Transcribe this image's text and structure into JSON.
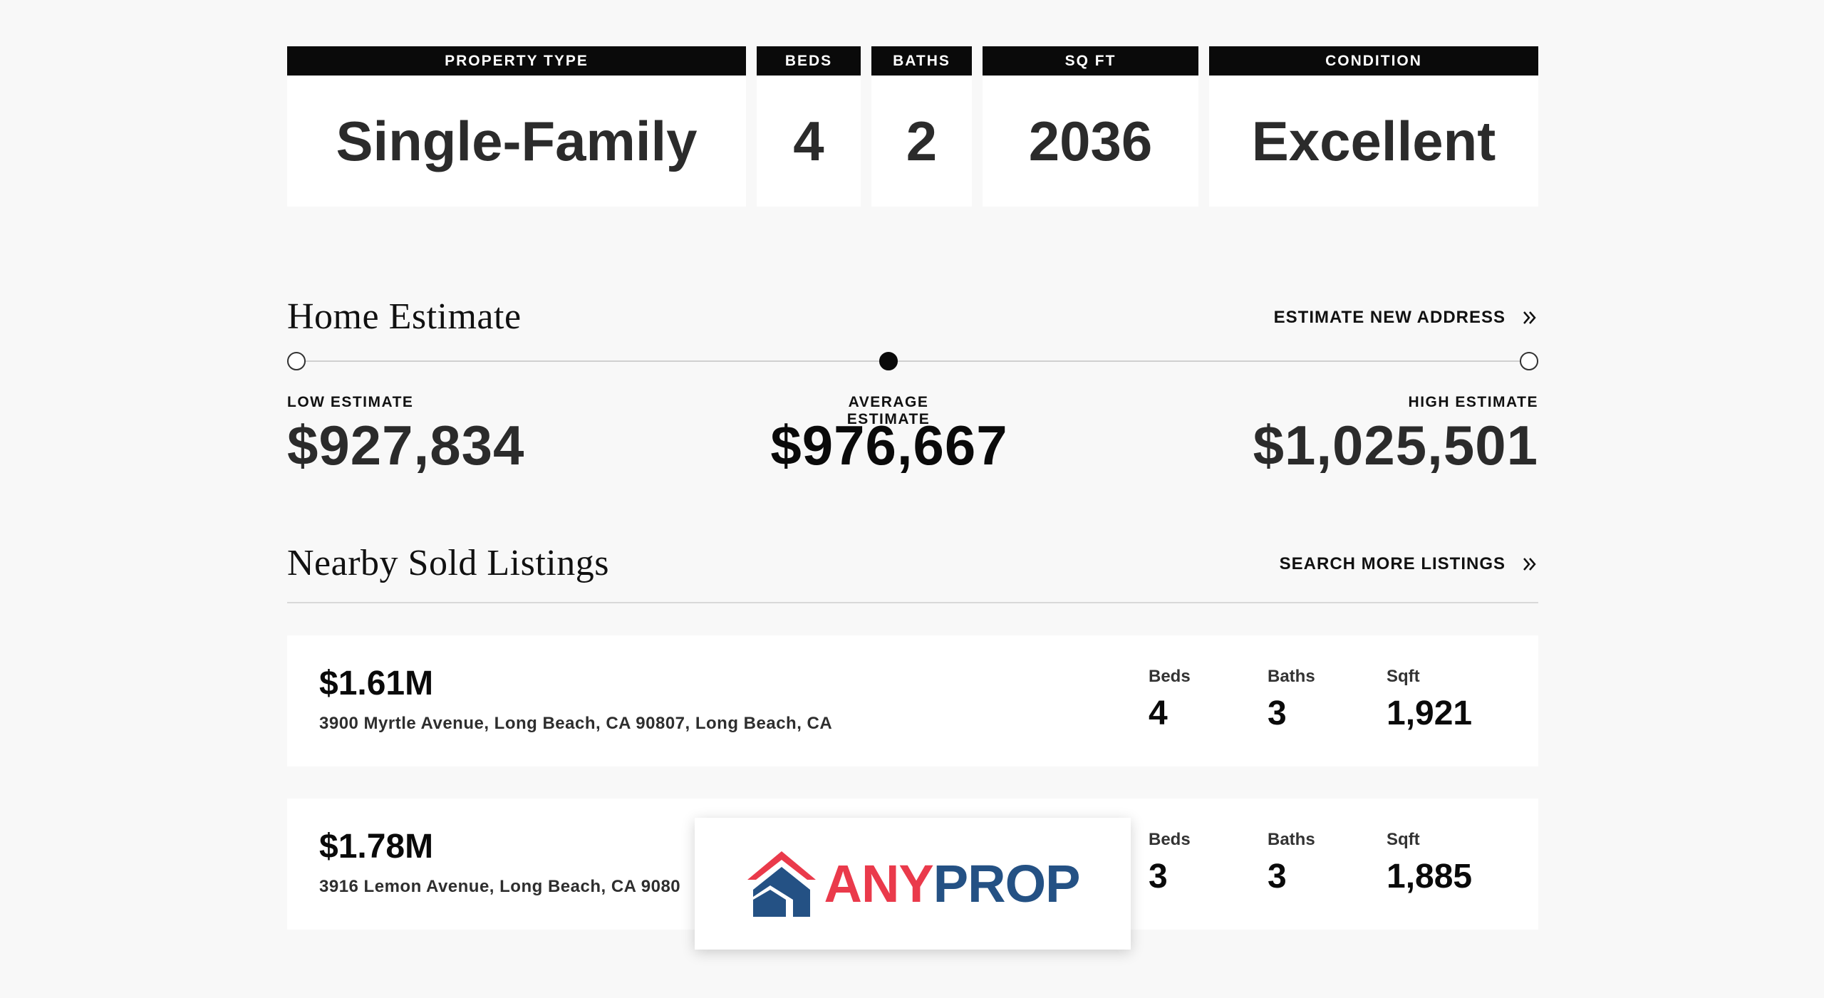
{
  "property_stats": [
    {
      "label": "PROPERTY TYPE",
      "value": "Single-Family"
    },
    {
      "label": "BEDS",
      "value": "4"
    },
    {
      "label": "BATHS",
      "value": "2"
    },
    {
      "label": "SQ FT",
      "value": "2036"
    },
    {
      "label": "CONDITION",
      "value": "Excellent"
    }
  ],
  "home_estimate": {
    "title": "Home Estimate",
    "link_label": "ESTIMATE NEW ADDRESS",
    "low_label": "LOW ESTIMATE",
    "low_value": "$927,834",
    "avg_label": "AVERAGE ESTIMATE",
    "avg_value": "$976,667",
    "high_label": "HIGH ESTIMATE",
    "high_value": "$1,025,501"
  },
  "nearby": {
    "title": "Nearby Sold Listings",
    "link_label": "SEARCH MORE LISTINGS",
    "listings": [
      {
        "price": "$1.61M",
        "address": "3900 Myrtle Avenue, Long Beach, CA 90807, Long Beach, CA",
        "beds_label": "Beds",
        "beds": "4",
        "baths_label": "Baths",
        "baths": "3",
        "sqft_label": "Sqft",
        "sqft": "1,921"
      },
      {
        "price": "$1.78M",
        "address": "3916 Lemon Avenue, Long Beach, CA 9080",
        "beds_label": "Beds",
        "beds": "3",
        "baths_label": "Baths",
        "baths": "3",
        "sqft_label": "Sqft",
        "sqft": "1,885"
      }
    ]
  },
  "logo": {
    "part1": "ANY",
    "part2": "PROP",
    "color1": "#ea3a4b",
    "color2": "#245184"
  },
  "icons": {
    "link_chevron": "double-chevron-right-icon",
    "logo_mark": "house-roof-icon"
  }
}
